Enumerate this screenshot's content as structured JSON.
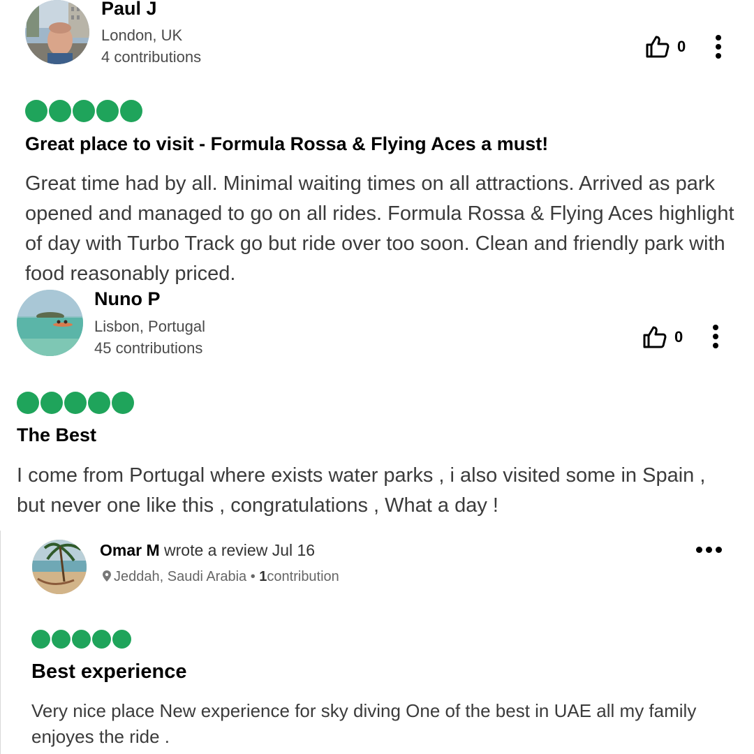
{
  "reviews": [
    {
      "author": "Paul J",
      "location": "London, UK",
      "contributions": "4 contributions",
      "likes": "0",
      "rating": 5,
      "title": "Great place to visit - Formula Rossa & Flying Aces a must!",
      "body": "Great time had by all. Minimal waiting times on all attractions. Arrived as park opened and managed to go on all rides. Formula Rossa & Flying Aces highlight of day with Turbo Track go but ride over too soon. Clean and friendly park with food reasonably priced."
    },
    {
      "author": "Nuno P",
      "location": "Lisbon, Portugal",
      "contributions": "45 contributions",
      "likes": "0",
      "rating": 5,
      "title": "The Best",
      "body": "I come from Portugal where exists water parks , i also visited some in Spain , but never one like this , congratulations , What a day !"
    },
    {
      "author": "Omar M",
      "wrote": "wrote a review Jul 16",
      "location": "Jeddah, Saudi Arabia •",
      "contribution_count": "1",
      "contribution_label": "contribution",
      "rating": 5,
      "title": "Best experience",
      "body": "Very nice place New experience for sky diving One of the best in UAE all my family enjoyes the ride ."
    }
  ],
  "colors": {
    "rating_bubble": "#1fa45b",
    "text_primary": "#000000",
    "text_secondary": "#4a4a4a"
  },
  "icons": [
    "thumbs-up-icon",
    "more-vertical-icon",
    "more-horizontal-icon",
    "location-pin-icon"
  ]
}
